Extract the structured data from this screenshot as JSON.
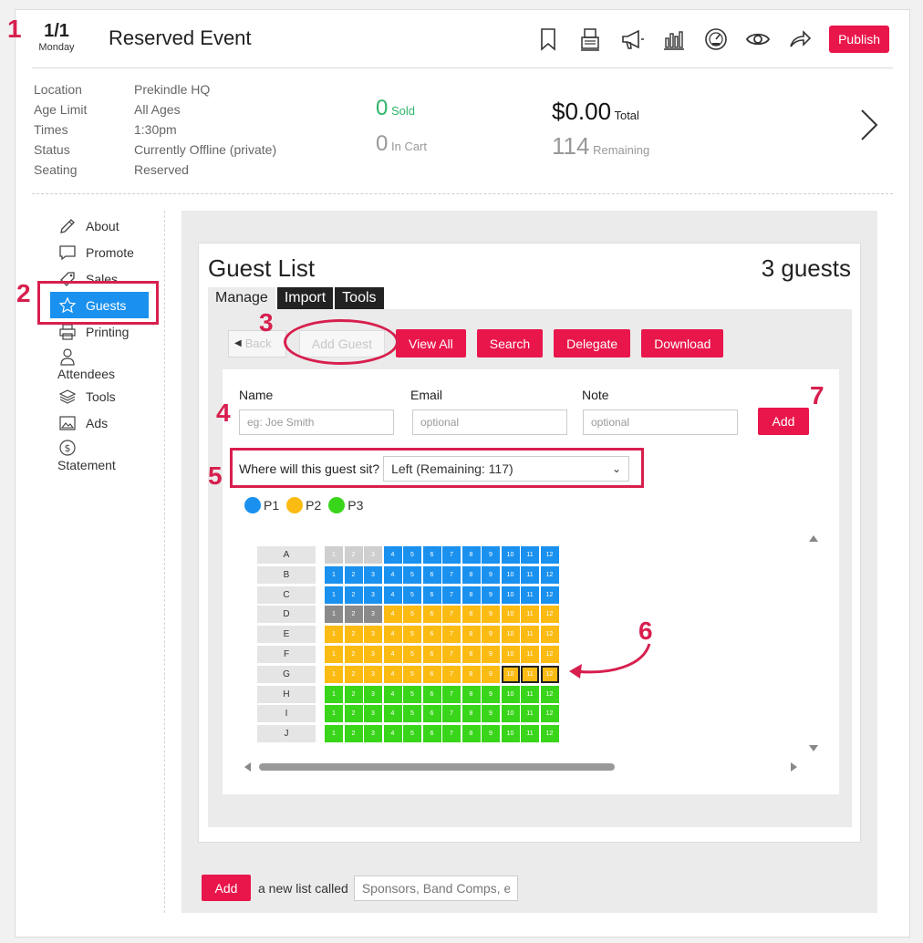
{
  "event": {
    "date_main": "1/1",
    "date_sub": "Monday",
    "title": "Reserved Event",
    "publish_label": "Publish"
  },
  "toolbar_icons": [
    "bookmark-icon",
    "register-icon",
    "megaphone-icon",
    "bar-chart-icon",
    "dashboard-icon",
    "eye-icon",
    "share-icon"
  ],
  "info": [
    {
      "label": "Location",
      "value": "Prekindle HQ"
    },
    {
      "label": "Age Limit",
      "value": "All Ages"
    },
    {
      "label": "Times",
      "value": "1:30pm"
    },
    {
      "label": "Status",
      "value": "Currently Offline (private)"
    },
    {
      "label": "Seating",
      "value": "Reserved"
    }
  ],
  "stats": {
    "sold_num": "0",
    "sold_label": "Sold",
    "cart_num": "0",
    "cart_label": "In Cart",
    "total_num": "$0.00",
    "total_label": "Total",
    "remaining_num": "114",
    "remaining_label": "Remaining"
  },
  "sidebar": [
    {
      "label": "About",
      "icon": "pencil-icon"
    },
    {
      "label": "Promote",
      "icon": "speech-bubble-icon"
    },
    {
      "label": "Sales",
      "icon": "tag-icon"
    },
    {
      "label": "Guests",
      "icon": "star-icon"
    },
    {
      "label": "Printing",
      "icon": "printer-icon"
    },
    {
      "label": "Attendees",
      "icon": "person-icon"
    },
    {
      "label": "Tools",
      "icon": "layers-icon"
    },
    {
      "label": "Ads",
      "icon": "image-icon"
    },
    {
      "label": "Statement",
      "icon": "dollar-icon"
    }
  ],
  "guest_list": {
    "title": "Guest List",
    "count": "3 guests",
    "tabs": [
      "Manage",
      "Import",
      "Tools"
    ],
    "back_label": "Back",
    "add_guest_label": "Add Guest",
    "view_all_label": "View All",
    "search_label": "Search",
    "delegate_label": "Delegate",
    "download_label": "Download",
    "name_label": "Name",
    "name_placeholder": "eg: Joe Smith",
    "email_label": "Email",
    "email_placeholder": "optional",
    "note_label": "Note",
    "note_placeholder": "optional",
    "add_label": "Add",
    "seat_question": "Where will this guest sit?",
    "seat_selected": "Left (Remaining: 117)"
  },
  "legend": [
    {
      "label": "P1",
      "color": "#1a91ef"
    },
    {
      "label": "P2",
      "color": "#fbbb12"
    },
    {
      "label": "P3",
      "color": "#39d51a"
    }
  ],
  "seat_rows": [
    {
      "row": "A",
      "seats": [
        "sold",
        "sold",
        "sold",
        "p1",
        "p1",
        "p1",
        "p1",
        "p1",
        "p1",
        "p1",
        "p1",
        "p1"
      ]
    },
    {
      "row": "B",
      "seats": [
        "p1",
        "p1",
        "p1",
        "p1",
        "p1",
        "p1",
        "p1",
        "p1",
        "p1",
        "p1",
        "p1",
        "p1"
      ]
    },
    {
      "row": "C",
      "seats": [
        "p1",
        "p1",
        "p1",
        "p1",
        "p1",
        "p1",
        "p1",
        "p1",
        "p1",
        "p1",
        "p1",
        "p1"
      ]
    },
    {
      "row": "D",
      "seats": [
        "dark",
        "dark",
        "dark",
        "p2",
        "p2",
        "p2",
        "p2",
        "p2",
        "p2",
        "p2",
        "p2",
        "p2"
      ]
    },
    {
      "row": "E",
      "seats": [
        "p2",
        "p2",
        "p2",
        "p2",
        "p2",
        "p2",
        "p2",
        "p2",
        "p2",
        "p2",
        "p2",
        "p2"
      ]
    },
    {
      "row": "F",
      "seats": [
        "p2",
        "p2",
        "p2",
        "p2",
        "p2",
        "p2",
        "p2",
        "p2",
        "p2",
        "p2",
        "p2",
        "p2"
      ]
    },
    {
      "row": "G",
      "seats": [
        "p2",
        "p2",
        "p2",
        "p2",
        "p2",
        "p2",
        "p2",
        "p2",
        "p2",
        "p2-sel",
        "p2-sel",
        "p2-sel"
      ]
    },
    {
      "row": "H",
      "seats": [
        "p3",
        "p3",
        "p3",
        "p3",
        "p3",
        "p3",
        "p3",
        "p3",
        "p3",
        "p3",
        "p3",
        "p3"
      ]
    },
    {
      "row": "I",
      "seats": [
        "p3",
        "p3",
        "p3",
        "p3",
        "p3",
        "p3",
        "p3",
        "p3",
        "p3",
        "p3",
        "p3",
        "p3"
      ]
    },
    {
      "row": "J",
      "seats": [
        "p3",
        "p3",
        "p3",
        "p3",
        "p3",
        "p3",
        "p3",
        "p3",
        "p3",
        "p3",
        "p3",
        "p3"
      ]
    }
  ],
  "bottom": {
    "add_label": "Add",
    "text": "a new list called",
    "placeholder": "Sponsors, Band Comps, etc"
  },
  "annotations": [
    "1",
    "2",
    "3",
    "4",
    "5",
    "6",
    "7"
  ],
  "colors": {
    "accent": "#e9164b",
    "active": "#1a91ef",
    "annotation": "#d71f4e",
    "sold_green": "#2fb56a"
  }
}
